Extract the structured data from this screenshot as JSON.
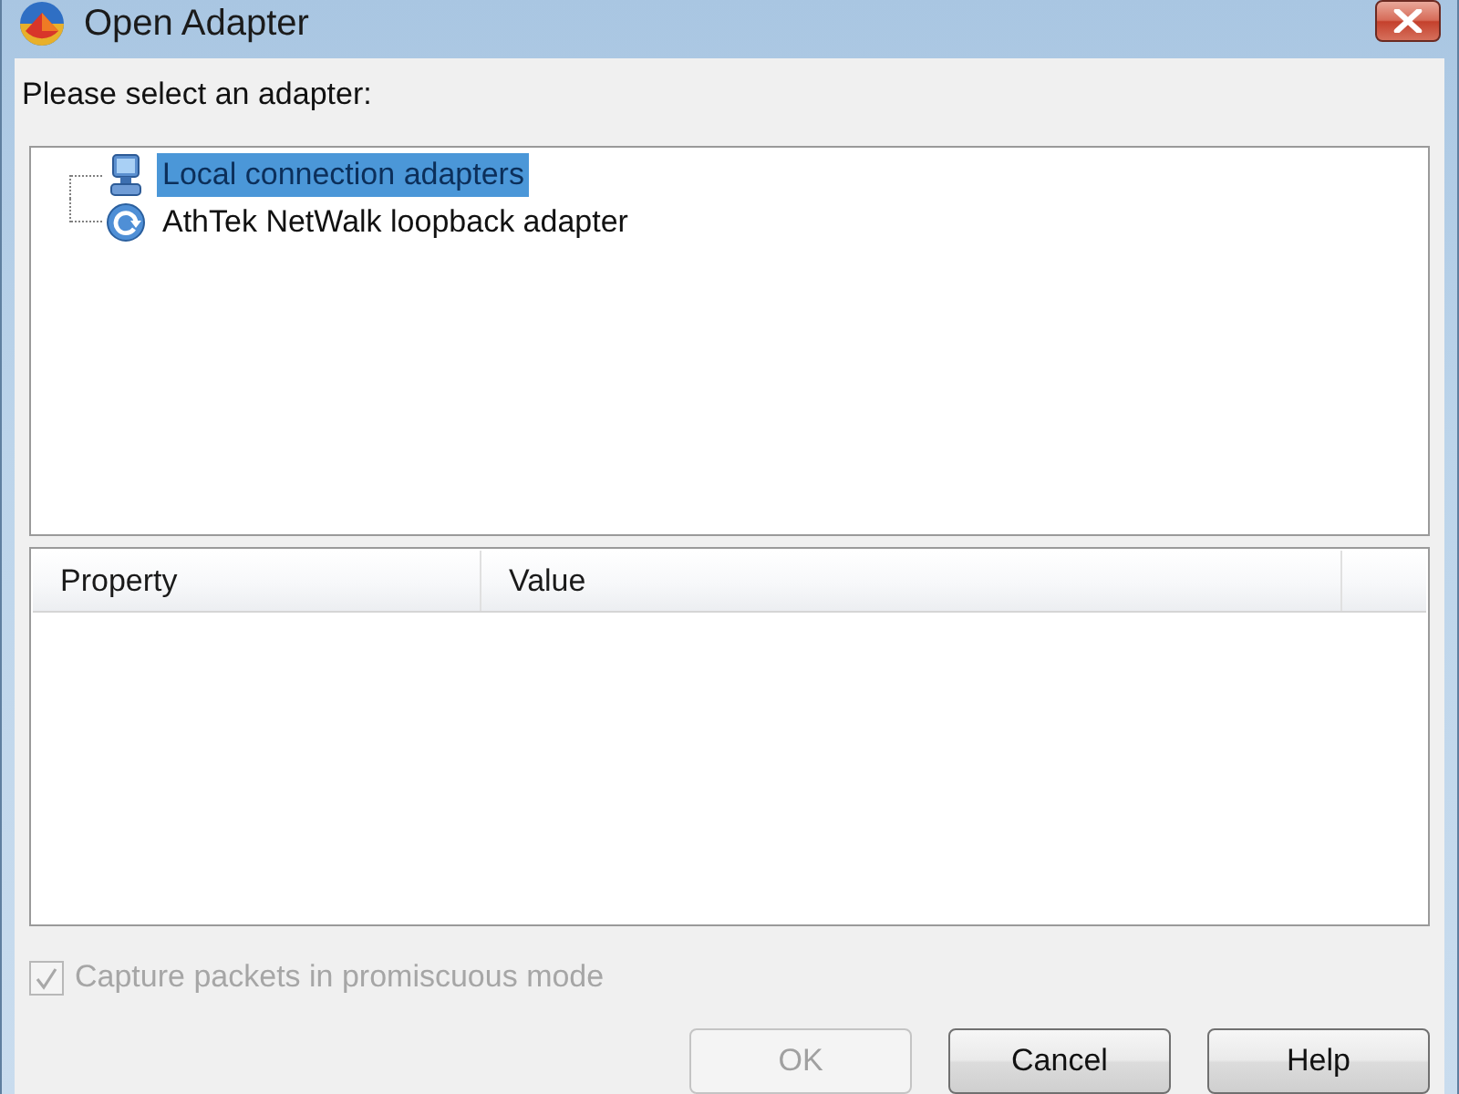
{
  "window": {
    "title": "Open Adapter"
  },
  "prompt": "Please select an adapter:",
  "adapter_tree": {
    "items": [
      {
        "label": "Local connection adapters",
        "kind": "local",
        "selected": true
      },
      {
        "label": "AthTek NetWalk loopback adapter",
        "kind": "loopback",
        "selected": false
      }
    ]
  },
  "property_list": {
    "columns": [
      "Property",
      "Value"
    ]
  },
  "promiscuous_checkbox": {
    "label": "Capture packets in promiscuous mode",
    "checked": true,
    "disabled": true
  },
  "buttons": [
    {
      "label": "OK",
      "disabled": true
    },
    {
      "label": "Cancel",
      "disabled": false
    },
    {
      "label": "Help",
      "disabled": false
    }
  ]
}
